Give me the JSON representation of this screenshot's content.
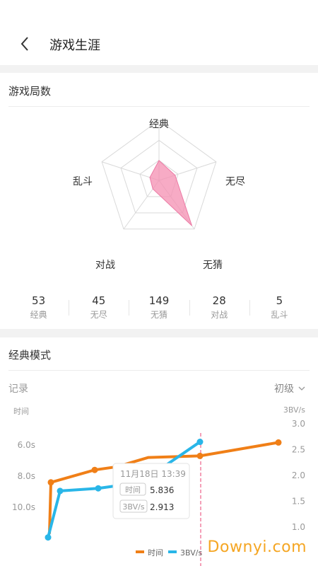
{
  "header": {
    "title": "游戏生涯",
    "back_icon": "chevron-left-icon"
  },
  "games_section": {
    "title": "游戏局数",
    "radar": {
      "labels": [
        "经典",
        "无尽",
        "无猜",
        "对战",
        "乱斗"
      ],
      "values": [
        53,
        45,
        149,
        28,
        5
      ],
      "max": 160,
      "fill_color": "#f48fb1"
    },
    "stats": [
      {
        "value": "53",
        "label": "经典"
      },
      {
        "value": "45",
        "label": "无尽"
      },
      {
        "value": "149",
        "label": "无猜"
      },
      {
        "value": "28",
        "label": "对战"
      },
      {
        "value": "5",
        "label": "乱斗"
      }
    ]
  },
  "classic_section": {
    "title": "经典模式",
    "records_label": "记录",
    "level": "初级",
    "left_axis_title": "时间",
    "right_axis_title": "3BV/s",
    "left_ticks": [
      "6.0s",
      "8.0s",
      "10.0s"
    ],
    "right_ticks": [
      "3.0",
      "2.5",
      "2.0",
      "1.5",
      "1.0"
    ],
    "tooltip": {
      "date": "11月18日 13:39",
      "time_tag": "时间",
      "time_value": "5.836",
      "bv_tag": "3BV/s",
      "bv_value": "2.913"
    },
    "legend": [
      {
        "name": "时间",
        "color": "#f07f17"
      },
      {
        "name": "3BV/s",
        "color": "#29b6e8"
      }
    ]
  },
  "chart_data": {
    "type": "line",
    "left_axis": {
      "label": "时间",
      "reversed": true,
      "ticks": [
        6.0,
        8.0,
        10.0
      ]
    },
    "right_axis": {
      "label": "3BV/s",
      "ticks": [
        1.0,
        1.5,
        2.0,
        2.5,
        3.0
      ]
    },
    "series": [
      {
        "name": "时间",
        "axis": "left",
        "color": "#f07f17",
        "values": [
          11.7,
          8.4,
          7.6,
          7.4,
          6.8,
          6.7,
          5.836
        ]
      },
      {
        "name": "3BV/s",
        "axis": "right",
        "color": "#29b6e8",
        "values": [
          0.8,
          1.7,
          1.75,
          1.8,
          2.2,
          2.65
        ]
      }
    ],
    "highlight": {
      "date": "11月18日 13:39",
      "time": 5.836,
      "bv": 2.913
    }
  },
  "watermark": "Downyi.com"
}
